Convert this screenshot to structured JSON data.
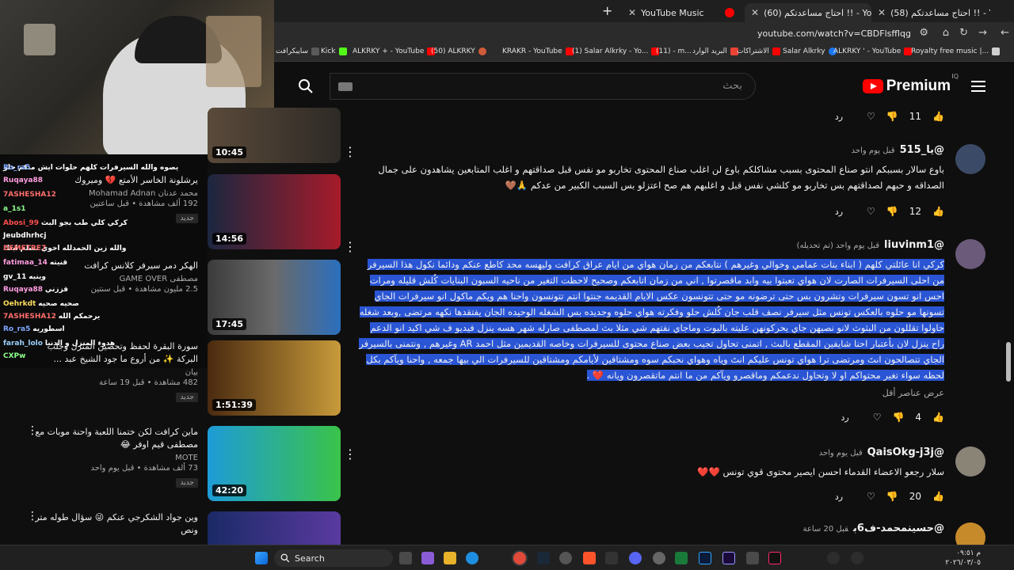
{
  "tabs": [
    {
      "label": "YouTube Music"
    },
    {
      "label": "(60) احتاج مساعدتكم !! - YouTube"
    },
    {
      "label": "(58) احتاج مساعدتكم !! - YouTube"
    }
  ],
  "address": {
    "url": "youtube.com/watch?v=CBDFlsfflqg"
  },
  "bookmarks": [
    {
      "label": "سايبكرافت"
    },
    {
      "label": "Kick"
    },
    {
      "label": "ALKRKY + - YouTube"
    },
    {
      "label": "(50) ALKRKY"
    },
    {
      "label": "KRAKR - YouTube"
    },
    {
      "label": "(1) Salar Alkrky - Yo..."
    },
    {
      "label": "(11) - m..."
    },
    {
      "label": "البريد الوارد"
    },
    {
      "label": "الاشتراكات"
    },
    {
      "label": "Salar Alkrky"
    },
    {
      "label": "ALKRKY ' - YouTube"
    },
    {
      "label": "Royalty free music |..."
    }
  ],
  "header": {
    "logo_text": "Premium",
    "logo_sup": "IQ",
    "search_placeholder": "بحث"
  },
  "chat": [
    {
      "user": "",
      "msg": "يصوه والله السيرفرات كلهم حلوات ايش متكم حلو"
    },
    {
      "user": "Ro_ra5",
      "msg": ""
    },
    {
      "user": "Ruqaya88",
      "msg": ""
    },
    {
      "user": "7ASHESHA12",
      "msg": ""
    },
    {
      "user": "a_1s1",
      "msg": ""
    },
    {
      "user": "Abosi_99",
      "msg": "كركي كلي طب بجو البث"
    },
    {
      "user": "Jeubdhrhcj",
      "msg": ""
    },
    {
      "user": "",
      "msg": "والله زين الحمدلله اخوي تسلم ابتك"
    },
    {
      "user": "DEMETRE7",
      "msg": ""
    },
    {
      "user": "fatimaa_14",
      "msg": "قنيته"
    },
    {
      "user": "gv_11",
      "msg": "وينيه"
    },
    {
      "user": "Ruqaya88",
      "msg": "قززني"
    },
    {
      "user": "Oehrkdt",
      "msg": "صحيه صحيه"
    },
    {
      "user": "7ASHESHA12",
      "msg": "يرحمكم الله"
    },
    {
      "user": "Ro_ra5",
      "msg": "اسطوريه"
    },
    {
      "user": "farah_lolo",
      "msg": "هدوء المنزل و الدنيا"
    },
    {
      "user": "CXPw",
      "msg": ""
    }
  ],
  "recs": [
    {
      "title": "يرشلونة الخاسر الأمتع 💔 وميروك",
      "channel": "محمد عدنان Mohamad Adnan",
      "views": "192 ألف مشاهدة • قبل ساعتين",
      "badge": "جديد",
      "duration": "14:56"
    },
    {
      "title": "الهكر دمر سيرفر كلانس كرافت",
      "channel": "مصطفى GAME OVER",
      "views": "2.5 مليون مشاهدة • قبل سنتين",
      "badge": "",
      "duration": "17:45"
    },
    {
      "title": "سورة البقرة لحفظ وتحصين المنزل وجلب البركة ✨ من أروع ما جود الشيخ عبد ...",
      "channel": "بيان",
      "views": "482 مشاهدة • قبل 19 ساعة",
      "badge": "جديد",
      "duration": "1:51:39"
    },
    {
      "title": "ماين كرافت لكن ختمنا اللعبة واحنة موبات مع مصطفى قيم اوفر 😂",
      "channel": "MOTE",
      "views": "73 ألف مشاهدة • قبل يوم واحد",
      "badge": "جديد",
      "duration": "42:20"
    },
    {
      "title": "وين جواد الشكرجي عنكم 😜 سؤال طوله متر ونص",
      "channel": "",
      "views": "",
      "badge": "",
      "duration": ""
    }
  ],
  "top_duration": "10:45",
  "comments": [
    {
      "name": "",
      "time": "",
      "text": "",
      "likes": "11",
      "reply": "رد"
    },
    {
      "name": "@يا_515",
      "time": "قبل يوم واحد",
      "text": "باوع سالار بسببكم انتو صناع المحتوى بسبب مشاكلكم باوع لن اغلب صناع المحتوى تخاربو مو نفس قبل صداقتهم و اغلب المتابعين يشاهدون على جمال الصداقه و حبهم لصداقتهم بس تخاربو مو كلشي نفس قبل و اغلبهم هم صح اعتزلو بس السبب الكبير من عدكم 🙏🤎",
      "likes": "12",
      "reply": "رد"
    },
    {
      "name": "@liuvinm1",
      "time": "قبل يوم واحد (تم تحديله)",
      "text": "كركي انا عائلتي كلهم ( ابناء بنات عمامي وخوالي وغيرهم ) نتابعكم من زمان هواي من ايام عراق كرافت وليهسه محد كاطع عنكم ودائما نكول هذا السيرفر من احلى السيرفرات الصارت لان هواي تعبتوا بيه وابد ماقصرتوا , اني من زمان اتابعكم وصحيح لاحظت التغير من ناحيه السبون البنايات كُلش قليله ومرات احس انو تسون سيرفرات وتشرون بس حتى ترضونه مو حتى تتونسون عكس الايام القديمه جنتوا انتم تتونسون واحنا هم ويكم ماكول انو سيرفرات الجاي تسونها مو حلوه بالعكس تونس مثل سيرفر نصف قلب جان كُلش حلو وفكرته هواي حلوه وجديده بس الشغله الوحيده الجان يفتقدها نكهه مرتضى ,وبعد شغله حاولوا تقللون من البثوث لانو نصيهن جاي يحركونهن عليته باليوت وماجاي نفتهم شي مثلا بث لمصطفى صارله شهر هسه ينزل فيديو ف شي اكيد انو الدعم راح ينزل لان بأعتبار احنا شايفين المقطع بالبث , اتمنى تحاول تجيب بعض صناع محتوى للسيرفرات وخاصه القديمين مثل احمد AR وغيرهم , ونتمنى بالسيرفر الجاي تتصالحون انتَ ومرتضى ترا هواي تونس عليكم انتَ وياه وهواي نحبكم سوه ومشتاقين لأيامكم ومشتاقين للسيرفرات الي بيها جمعه , واحنا ويآكم بكل لحظه سواء تغير محتواكم او لا وتحاول ندعمكم وماقصرو ويآكم من ما انتم ماتقصرون ويانه ❤️ .",
      "likes": "4",
      "reply": "رد",
      "more": "عرض عناصر أقل"
    },
    {
      "name": "@QaisOkg-j3j",
      "time": "قبل يوم واحد",
      "text": "سلار رجعو الاعضاء القدماء احسن ايصير محتوى قوي تونس ❤️❤️",
      "likes": "20",
      "reply": "رد"
    },
    {
      "name": "@حسينمحمد-ف6ب",
      "time": "قبل 20 ساعة",
      "text": "",
      "likes": "",
      "reply": ""
    }
  ],
  "taskbar": {
    "search_label": "Search",
    "time": "م ٠٩:٥١",
    "date": "٢٠٢٦/٠٣/٠٥"
  },
  "colors": {
    "selection": "#2a55d4",
    "youtube_red": "#ff0000",
    "background": "#0f0f0f"
  }
}
